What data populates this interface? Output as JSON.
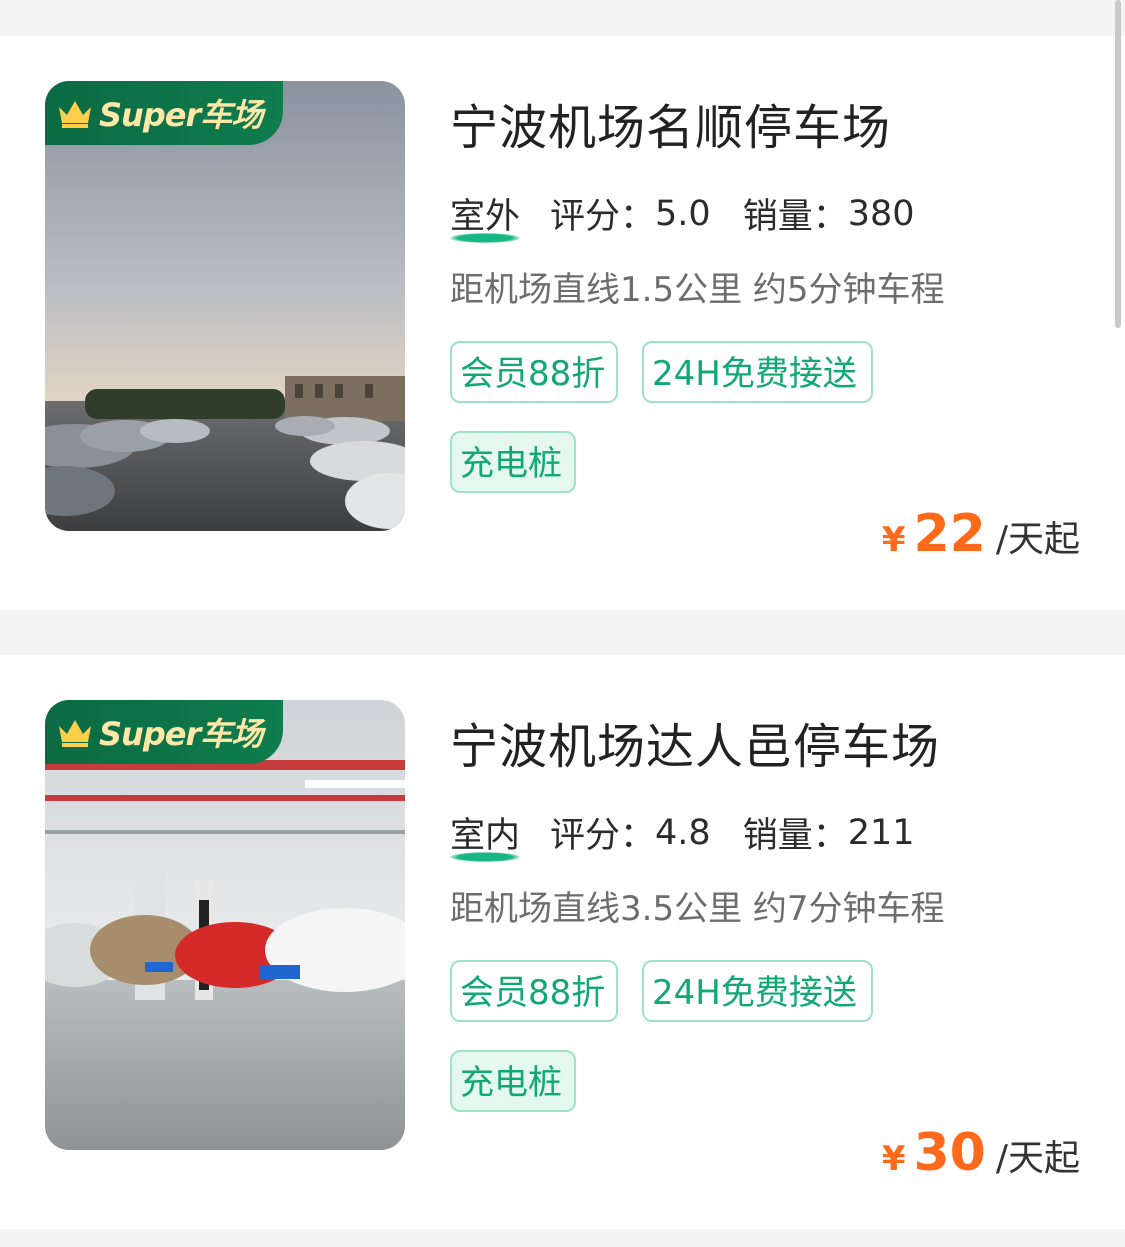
{
  "lots": [
    {
      "badge": "Super车场",
      "name": "宁波机场名顺停车场",
      "location_type": "室外",
      "rating_label": "评分：",
      "rating": "5.0",
      "sales_label": "销量：",
      "sales": "380",
      "distance": "距机场直线1.5公里 约5分钟车程",
      "tags": [
        "会员88折",
        "24H免费接送",
        "充电桩"
      ],
      "currency": "¥",
      "price": "22",
      "price_unit": "/天起"
    },
    {
      "badge": "Super车场",
      "name": "宁波机场达人邑停车场",
      "location_type": "室内",
      "rating_label": "评分：",
      "rating": "4.8",
      "sales_label": "销量：",
      "sales": "211",
      "distance": "距机场直线3.5公里 约7分钟车程",
      "tags": [
        "会员88折",
        "24H免费接送",
        "充电桩"
      ],
      "currency": "¥",
      "price": "30",
      "price_unit": "/天起"
    }
  ],
  "colors": {
    "accent_green": "#12a874",
    "price_orange": "#ff6a1a",
    "badge_green": "#0b6a42",
    "badge_gold": "#ffe7a8"
  },
  "icons": {
    "badge_icon": "crown-icon"
  }
}
